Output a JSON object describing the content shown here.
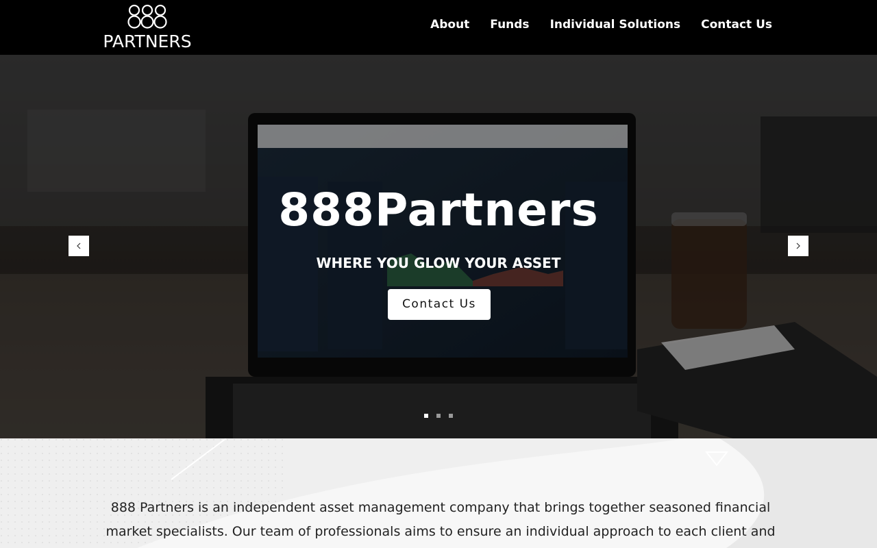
{
  "header": {
    "logo": {
      "mark": "888",
      "text": "PARTNERS"
    },
    "nav": [
      {
        "label": "About"
      },
      {
        "label": "Funds"
      },
      {
        "label": "Individual Solutions"
      },
      {
        "label": "Contact Us"
      }
    ]
  },
  "hero": {
    "title": "888Partners",
    "subtitle": "WHERE YOU GLOW YOUR ASSET",
    "cta_label": "Contact Us",
    "slides_total": 3,
    "active_slide": 1,
    "prev_icon": "chevron-left-icon",
    "next_icon": "chevron-right-icon"
  },
  "about": {
    "icon": "triangle-down-icon",
    "text": "888 Partners is an independent asset management company that brings together seasoned financial market specialists. Our team of professionals aims to ensure an individual approach to each client and to"
  },
  "colors": {
    "header_bg": "#000000",
    "nav_text": "#ffffff",
    "button_bg": "#ffffff",
    "about_bg": "#efefef",
    "about_text": "#222222"
  }
}
